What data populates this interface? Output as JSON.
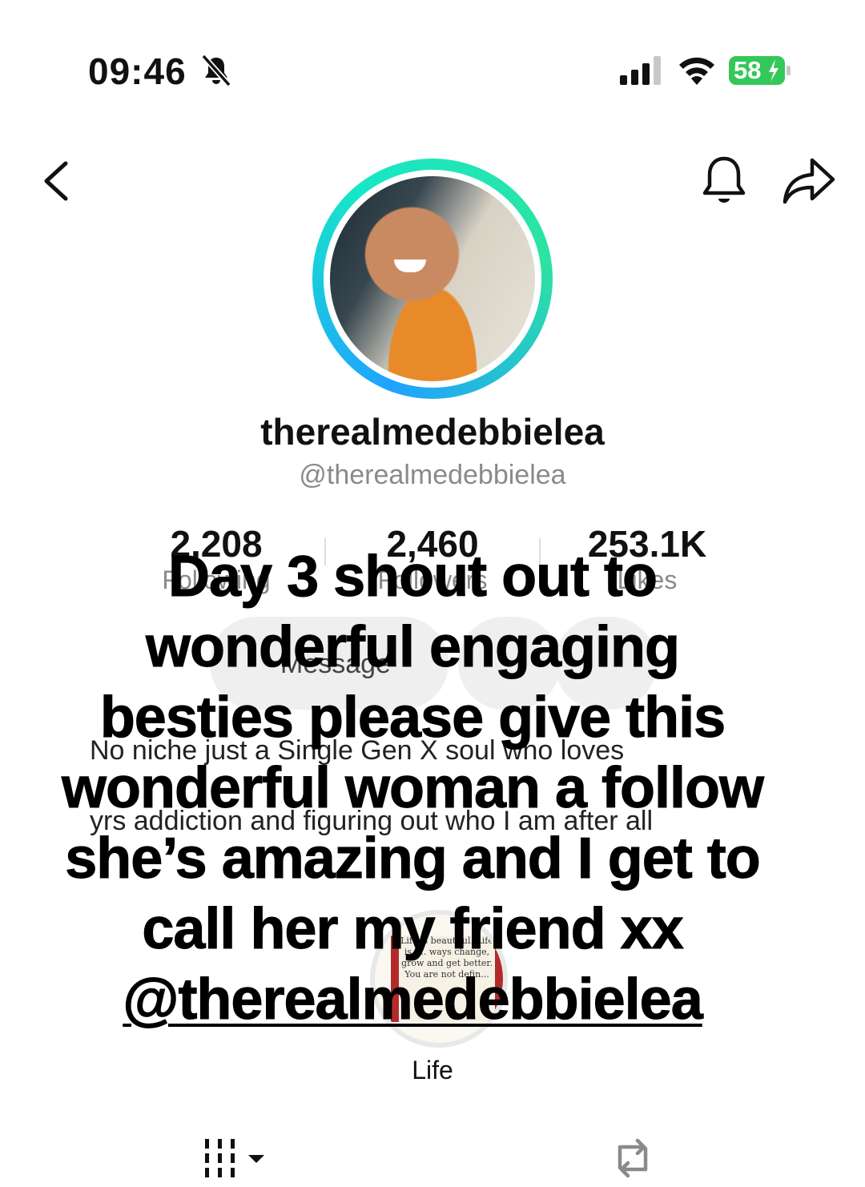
{
  "status_bar": {
    "time": "09:46",
    "battery": "58",
    "icons": [
      "bell-muted-icon",
      "signal-icon",
      "wifi-icon",
      "battery-charging-icon"
    ],
    "battery_color": "#34c759"
  },
  "nav": {
    "icons": [
      "back-icon",
      "notification-bell-icon",
      "share-icon"
    ]
  },
  "profile": {
    "display_name": "therealmedebbielea",
    "handle": "@therealmedebbielea",
    "ring_colors": [
      "#1fa2ff",
      "#17e6c8"
    ]
  },
  "stats": [
    {
      "value": "2,208",
      "label": "Following"
    },
    {
      "value": "2,460",
      "label": "Followers"
    },
    {
      "value": "253.1K",
      "label": "Likes"
    }
  ],
  "actions": {
    "message_label": "Message"
  },
  "bio": {
    "line1": "No niche just a Single Gen X soul who loves",
    "line2": "yrs addiction and figuring out who I am after all"
  },
  "highlight": {
    "label": "Life",
    "book_text": "Life is beautiful. Life is t... ways change, grow and get better. You are not defin..."
  },
  "tabs": {
    "icons": [
      "videos-grid-icon",
      "repost-icon"
    ]
  },
  "overlay": {
    "line1": "Day 3 shout out to",
    "line2": "wonderful engaging",
    "line3": "besties please give this",
    "line4": "wonderful woman a follow",
    "line5": "she’s amazing and I get to",
    "line6": "call her my friend xx",
    "mention": "@therealmedebbielea"
  }
}
